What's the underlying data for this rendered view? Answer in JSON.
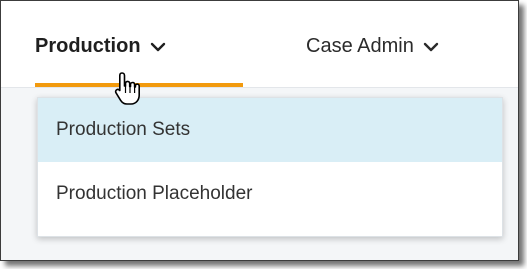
{
  "nav": {
    "production_label": "Production",
    "case_admin_label": "Case Admin"
  },
  "dropdown": {
    "items": [
      {
        "label": "Production Sets",
        "hovered": true
      },
      {
        "label": "Production Placeholder",
        "hovered": false
      }
    ]
  },
  "colors": {
    "accent_underline": "#f29a0e",
    "hover_background": "#d9eef6"
  },
  "icons": {
    "nav_chevron": "chevron-down-icon",
    "pointer": "hand-pointer-cursor-icon"
  }
}
